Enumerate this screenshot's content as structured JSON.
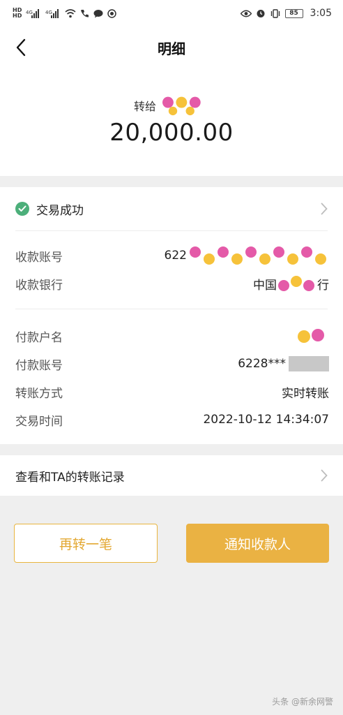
{
  "status_bar": {
    "sim1": "HD",
    "sim2": "HD",
    "signal": "⁴ᴳ▐▌",
    "signal2": "⁴ᴳ▐▌",
    "battery": "85",
    "time": "3:05"
  },
  "nav": {
    "title": "明细"
  },
  "header": {
    "transfer_to_label": "转给",
    "amount": "20,000.00"
  },
  "status": {
    "label": "交易成功",
    "color": "#4caf7a"
  },
  "payee": {
    "account_label": "收款账号",
    "account_value": "622",
    "bank_label": "收款银行",
    "bank_value_prefix": "中国",
    "bank_value_suffix": "行"
  },
  "payer": {
    "name_label": "付款户名",
    "account_label": "付款账号",
    "account_value": "6228***",
    "method_label": "转账方式",
    "method_value": "实时转账",
    "time_label": "交易时间",
    "time_value": "2022-10-12 14:34:07"
  },
  "history": {
    "label": "查看和TA的转账记录"
  },
  "actions": {
    "again_label": "再转一笔",
    "notify_label": "通知收款人",
    "accent_color": "#eab243"
  },
  "watermark": {
    "text": "头条 @新余网警"
  }
}
